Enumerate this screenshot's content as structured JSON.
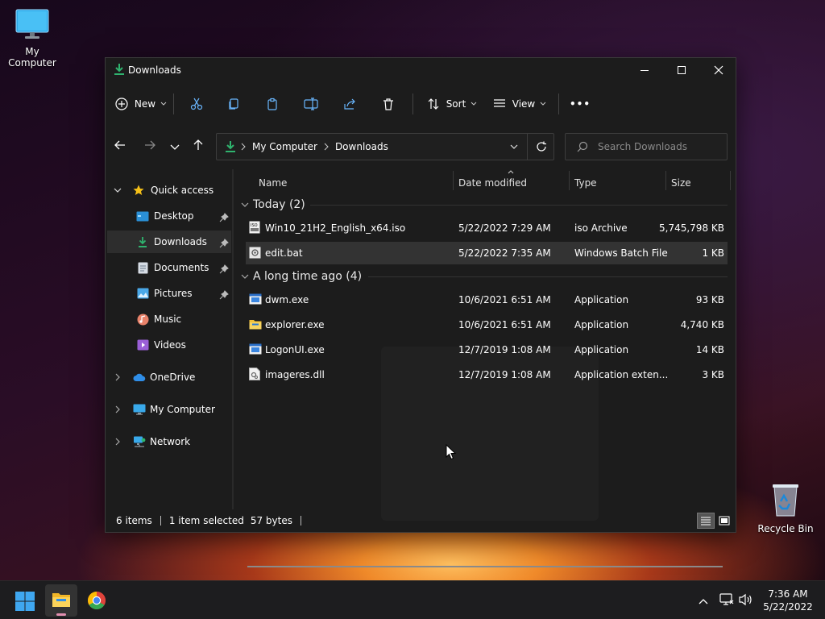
{
  "desktop": {
    "my_computer_label": "My Computer",
    "recycle_bin_label": "Recycle Bin"
  },
  "window": {
    "title": "Downloads",
    "toolbar": {
      "new_label": "New",
      "sort_label": "Sort",
      "view_label": "View",
      "more_label": "•••"
    },
    "address": {
      "crumbs": [
        "My Computer",
        "Downloads"
      ]
    },
    "search": {
      "placeholder": "Search Downloads"
    },
    "sidebar": {
      "quick_access": "Quick access",
      "items": [
        {
          "label": "Desktop",
          "icon": "desktop-icon",
          "pinned": true
        },
        {
          "label": "Downloads",
          "icon": "download-icon",
          "pinned": true,
          "selected": true
        },
        {
          "label": "Documents",
          "icon": "documents-icon",
          "pinned": true
        },
        {
          "label": "Pictures",
          "icon": "pictures-icon",
          "pinned": true
        },
        {
          "label": "Music",
          "icon": "music-icon",
          "pinned": false
        },
        {
          "label": "Videos",
          "icon": "videos-icon",
          "pinned": false
        }
      ],
      "onedrive": "OneDrive",
      "my_computer": "My Computer",
      "network": "Network"
    },
    "columns": {
      "name": "Name",
      "date": "Date modified",
      "type": "Type",
      "size": "Size"
    },
    "groups": [
      {
        "label": "Today (2)",
        "files": [
          {
            "name": "Win10_21H2_English_x64.iso",
            "date": "5/22/2022 7:29 AM",
            "type": "iso Archive",
            "size": "5,745,798 KB",
            "icon": "iso-icon"
          },
          {
            "name": "edit.bat",
            "date": "5/22/2022 7:35 AM",
            "type": "Windows Batch File",
            "size": "1 KB",
            "icon": "batch-file-icon",
            "selected": true
          }
        ]
      },
      {
        "label": "A long time ago (4)",
        "files": [
          {
            "name": "dwm.exe",
            "date": "10/6/2021 6:51 AM",
            "type": "Application",
            "size": "93 KB",
            "icon": "exe-icon"
          },
          {
            "name": "explorer.exe",
            "date": "10/6/2021 6:51 AM",
            "type": "Application",
            "size": "4,740 KB",
            "icon": "folder-app-icon"
          },
          {
            "name": "LogonUI.exe",
            "date": "12/7/2019 1:08 AM",
            "type": "Application",
            "size": "14 KB",
            "icon": "exe-icon"
          },
          {
            "name": "imageres.dll",
            "date": "12/7/2019 1:08 AM",
            "type": "Application exten...",
            "size": "3 KB",
            "icon": "dll-icon"
          }
        ]
      }
    ],
    "status": {
      "items": "6 items",
      "selected": "1 item selected",
      "bytes": "57 bytes"
    }
  },
  "taskbar": {
    "time": "7:36 AM",
    "date": "5/22/2022"
  },
  "colors": {
    "accent_green": "#2fb36e",
    "window_bg": "#1c1c1c",
    "selected_row": "#333333",
    "taskbar_bg": "#1d1d1f"
  }
}
